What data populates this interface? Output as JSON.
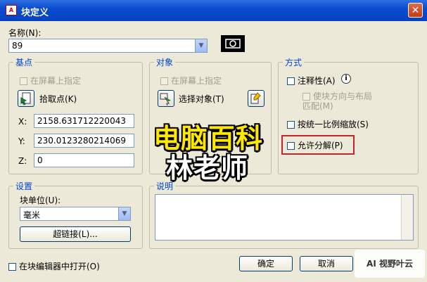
{
  "window": {
    "title": "块定义",
    "app_icon_text": "A",
    "close_glyph": "✕"
  },
  "name": {
    "label": "名称(N):",
    "value": "89"
  },
  "base_point": {
    "title": "基点",
    "specify_on_screen": "在屏幕上指定",
    "pick_button": "拾取点(K)",
    "x_label": "X:",
    "x_value": "2158.631712220043",
    "y_label": "Y:",
    "y_value": "230.0123280214069",
    "z_label": "Z:",
    "z_value": "0"
  },
  "objects": {
    "title": "对象",
    "specify_on_screen": "在屏幕上指定",
    "select_button": "选择对象(T)"
  },
  "behavior": {
    "title": "方式",
    "annotative": "注释性(A)",
    "match_orientation": "使块方向与布局匹配(M)",
    "scale_uniformly": "按统一比例缩放(S)",
    "allow_exploding": "允许分解(P)"
  },
  "settings": {
    "title": "设置",
    "unit_label": "块单位(U):",
    "unit_value": "毫米",
    "hyperlink_button": "超链接(L)..."
  },
  "description": {
    "title": "说明"
  },
  "footer": {
    "open_in_editor": "在块编辑器中打开(O)",
    "ok": "确定",
    "cancel": "取消"
  },
  "overlay": {
    "line1": "电脑百科",
    "line2": "林老师",
    "watermark": "AI 视野叶云"
  },
  "colors": {
    "highlight_box": "#c8222a",
    "group_title": "#0046d5"
  }
}
